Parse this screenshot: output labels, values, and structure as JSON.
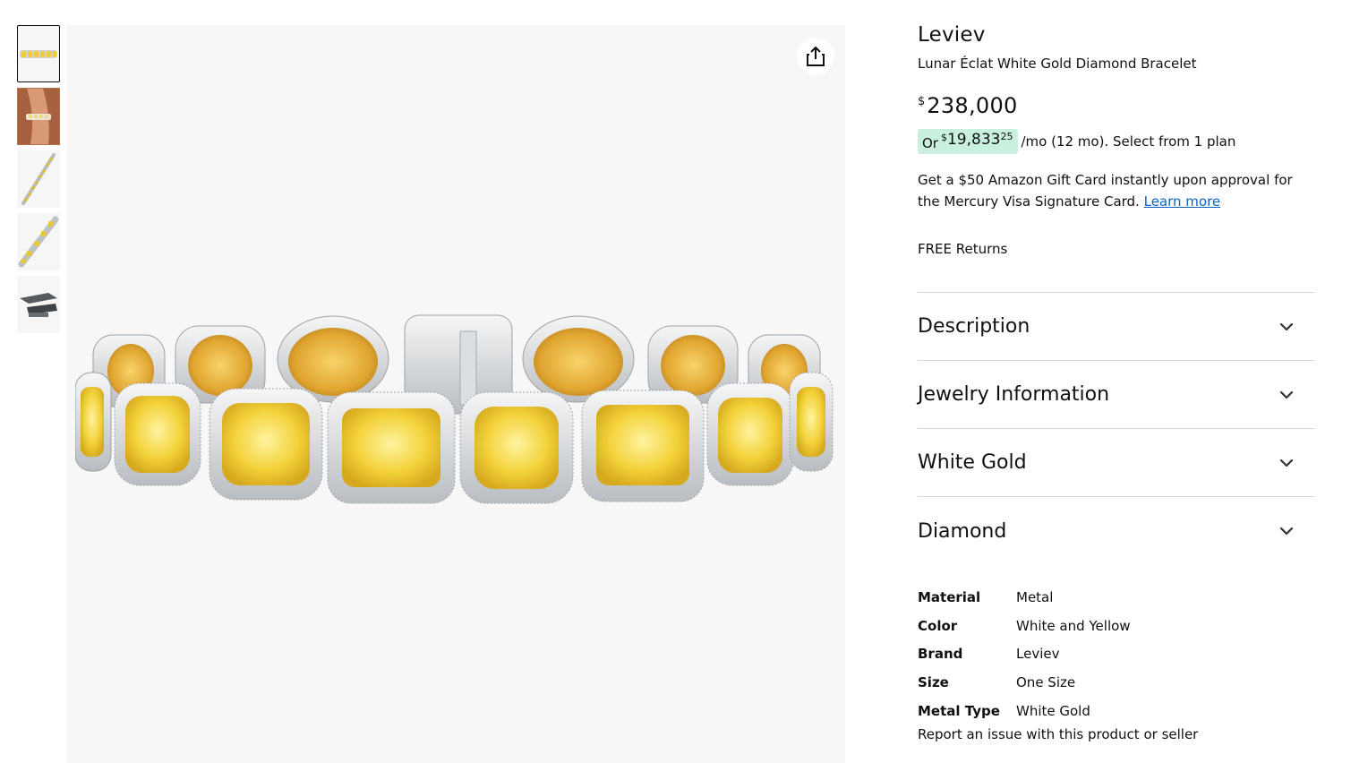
{
  "thumbnails": [
    {
      "name": "thumb-bracelet-front",
      "active": true
    },
    {
      "name": "thumb-bracelet-on-wrist",
      "active": false
    },
    {
      "name": "thumb-bracelet-diagonal",
      "active": false
    },
    {
      "name": "thumb-bracelet-closeup",
      "active": false
    },
    {
      "name": "thumb-bracelet-clasp",
      "active": false
    }
  ],
  "icons": {
    "share": "share-icon",
    "chevron": "chevron-down-icon"
  },
  "product": {
    "brand": "Leviev",
    "title": "Lunar Éclat White Gold Diamond Bracelet",
    "price_currency": "$",
    "price_amount": "238,000",
    "monthly_or": "Or",
    "monthly_currency": "$",
    "monthly_amount": "19,833",
    "monthly_cents": "25",
    "monthly_rest": "/mo (12 mo). Select from 1 plan",
    "promo_text": "Get a $50 Amazon Gift Card instantly upon approval for the Mercury Visa Signature Card.",
    "promo_link": "Learn more",
    "returns": "FREE Returns"
  },
  "accordion": [
    {
      "label": "Description"
    },
    {
      "label": "Jewelry Information"
    },
    {
      "label": "White Gold"
    },
    {
      "label": "Diamond"
    }
  ],
  "specs": [
    {
      "key": "Material",
      "value": "Metal"
    },
    {
      "key": "Color",
      "value": "White and Yellow"
    },
    {
      "key": "Brand",
      "value": "Leviev"
    },
    {
      "key": "Size",
      "value": "One Size"
    },
    {
      "key": "Metal Type",
      "value": "White Gold"
    }
  ],
  "report": "Report an issue with this product or seller",
  "colors": {
    "accent_link": "#0a63c4",
    "monthly_highlight": "#c9f0de",
    "divider": "#d5d9d9",
    "stone_yellow": "#f2cf2e",
    "metal": "#d9dcdf"
  }
}
